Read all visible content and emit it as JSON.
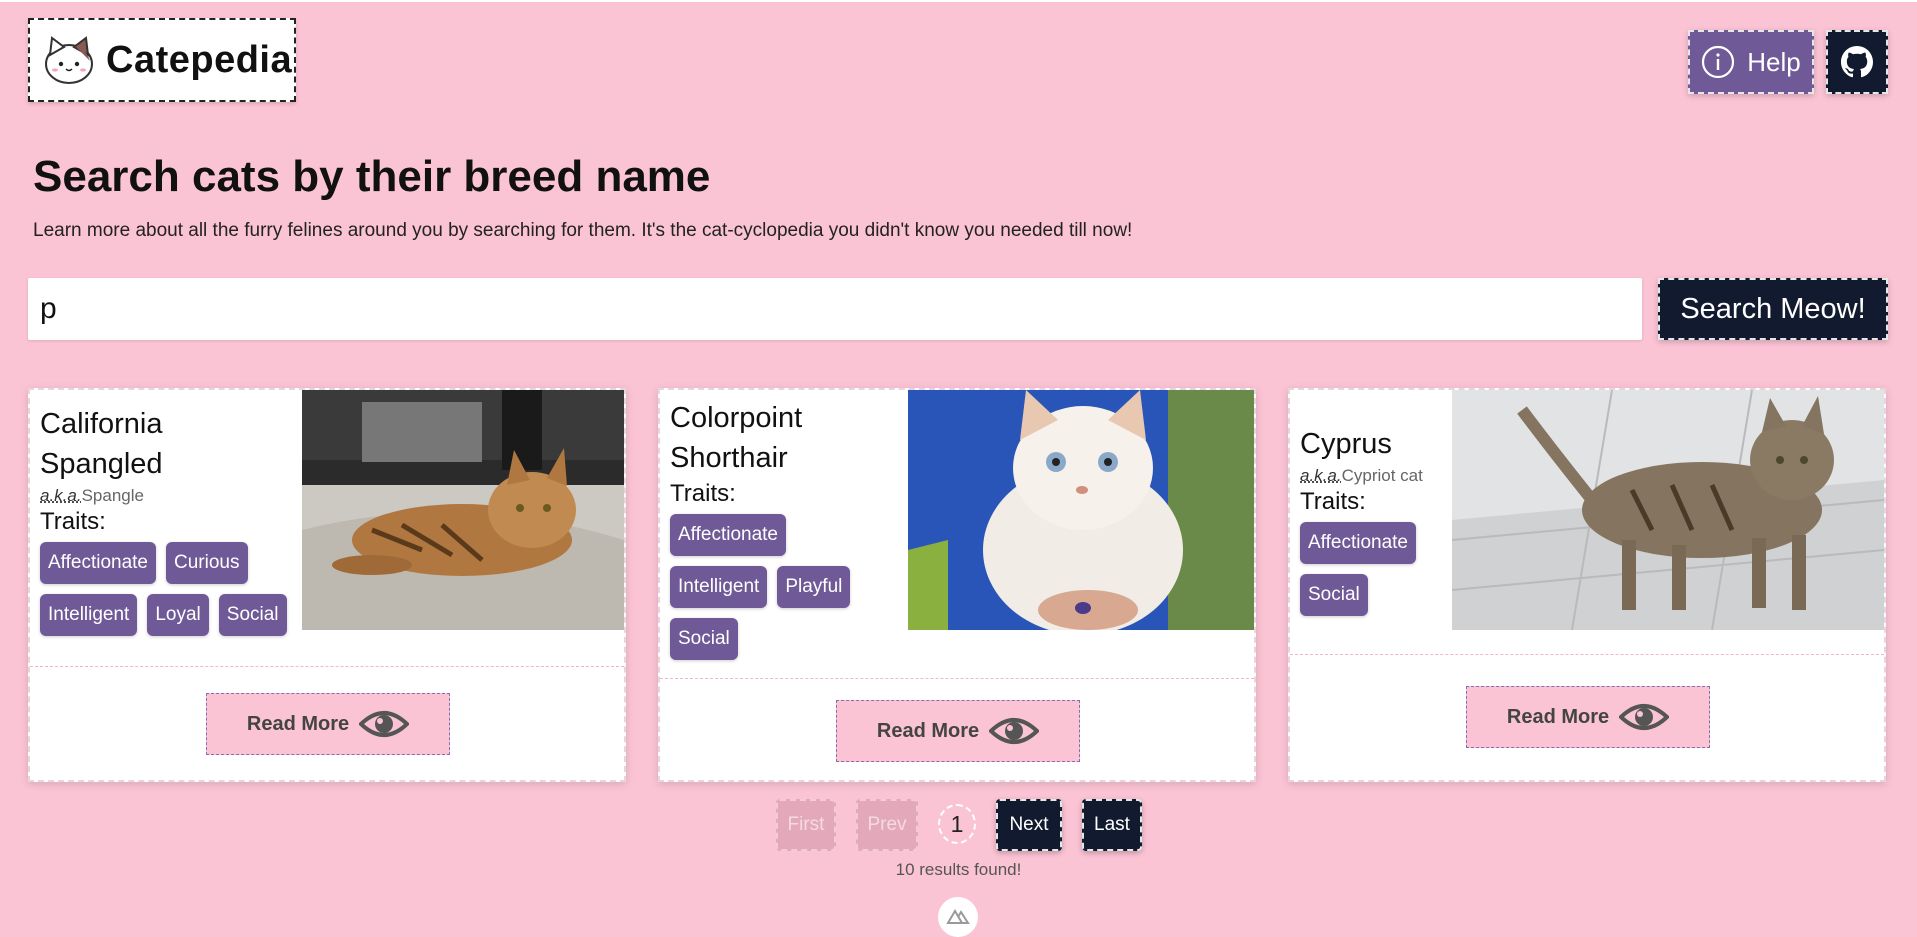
{
  "header": {
    "logo_text": "Catepedia",
    "help_label": "Help",
    "github_icon": "github-icon",
    "info_icon": "info-circle-icon"
  },
  "hero": {
    "title": "Search cats by their breed name",
    "subtitle": "Learn more about all the furry felines around you by searching for them. It's the cat-cyclopedia you didn't know you needed till now!"
  },
  "search": {
    "value": "p",
    "button_label": "Search Meow!"
  },
  "cards": [
    {
      "name_line1": "California",
      "name_line2": "Spangled",
      "aka_label": "a.k.a.",
      "aka_value": "Spangle",
      "traits_label": "Traits:",
      "traits": [
        "Affectionate",
        "Curious",
        "Intelligent",
        "Loyal",
        "Social"
      ],
      "read_more": "Read More",
      "image": "tabby cat lying on carpet"
    },
    {
      "name_line1": "Colorpoint",
      "name_line2": "Shorthair",
      "traits_label": "Traits:",
      "traits": [
        "Affectionate",
        "Intelligent",
        "Playful",
        "Social"
      ],
      "read_more": "Read More",
      "image": "white cream cat held by person"
    },
    {
      "name_line1": "Cyprus",
      "aka_label": "a.k.a.",
      "aka_value": "Cypriot cat",
      "traits_label": "Traits:",
      "traits": [
        "Affectionate",
        "Social"
      ],
      "read_more": "Read More",
      "image": "tabby cat standing on tiles"
    }
  ],
  "pagination": {
    "first": "First",
    "prev": "Prev",
    "page": "1",
    "next": "Next",
    "last": "Last"
  },
  "results_text": "10 results found!",
  "colors": {
    "background": "#fbc4d5",
    "accent": "#6f5a97",
    "dark": "#111a2e"
  }
}
